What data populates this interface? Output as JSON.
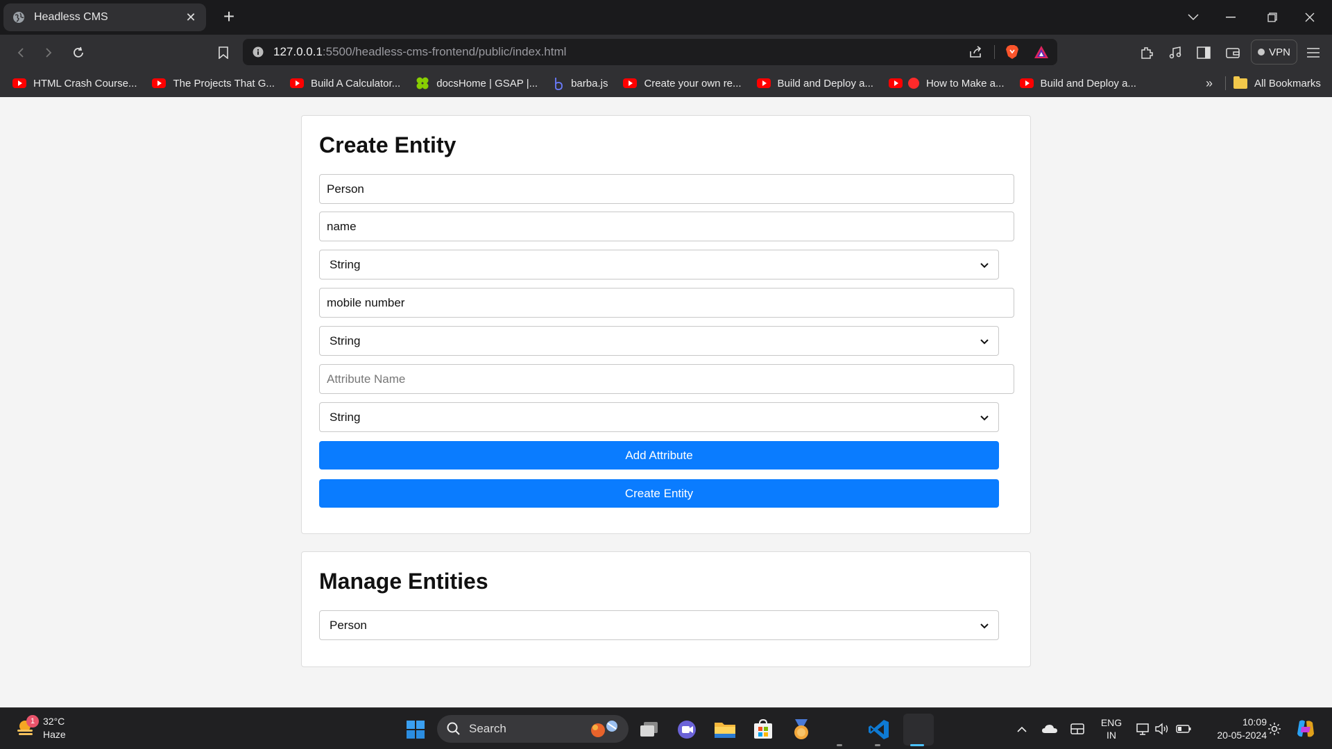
{
  "browser": {
    "tab_title": "Headless CMS",
    "url_host": "127.0.0.1",
    "url_rest": ":5500/headless-cms-frontend/public/index.html",
    "vpn_label": "VPN"
  },
  "bookmarks": {
    "items": [
      {
        "label": "HTML Crash Course...",
        "icon": "youtube-icon"
      },
      {
        "label": "The Projects That G...",
        "icon": "youtube-icon"
      },
      {
        "label": "Build A Calculator...",
        "icon": "youtube-icon"
      },
      {
        "label": "docsHome | GSAP |...",
        "icon": "gsap-icon"
      },
      {
        "label": "barba.js",
        "icon": "barba-icon"
      },
      {
        "label": "Create your own re...",
        "icon": "youtube-icon"
      },
      {
        "label": "Build and Deploy a...",
        "icon": "youtube-icon"
      },
      {
        "label": "How to Make a...",
        "icon": "youtube-icon"
      },
      {
        "label": "Build and Deploy a...",
        "icon": "youtube-icon"
      }
    ],
    "more": "»",
    "all_bookmarks": "All Bookmarks"
  },
  "create_entity": {
    "heading": "Create Entity",
    "entity_name_value": "Person",
    "attributes": [
      {
        "name_value": "name",
        "type_value": "String"
      },
      {
        "name_value": "mobile number",
        "type_value": "String"
      },
      {
        "name_placeholder": "Attribute Name",
        "type_value": "String"
      }
    ],
    "add_attribute_label": "Add Attribute",
    "create_entity_label": "Create Entity"
  },
  "manage_entities": {
    "heading": "Manage Entities",
    "selected_entity": "Person"
  },
  "taskbar": {
    "weather_temp": "32°C",
    "weather_desc": "Haze",
    "weather_badge": "1",
    "search_label": "Search",
    "lang_top": "ENG",
    "lang_bottom": "IN",
    "time": "10:09",
    "date": "20-05-2024"
  },
  "colors": {
    "accent_button": "#0a7cff",
    "brave_orange": "#fb542b"
  }
}
